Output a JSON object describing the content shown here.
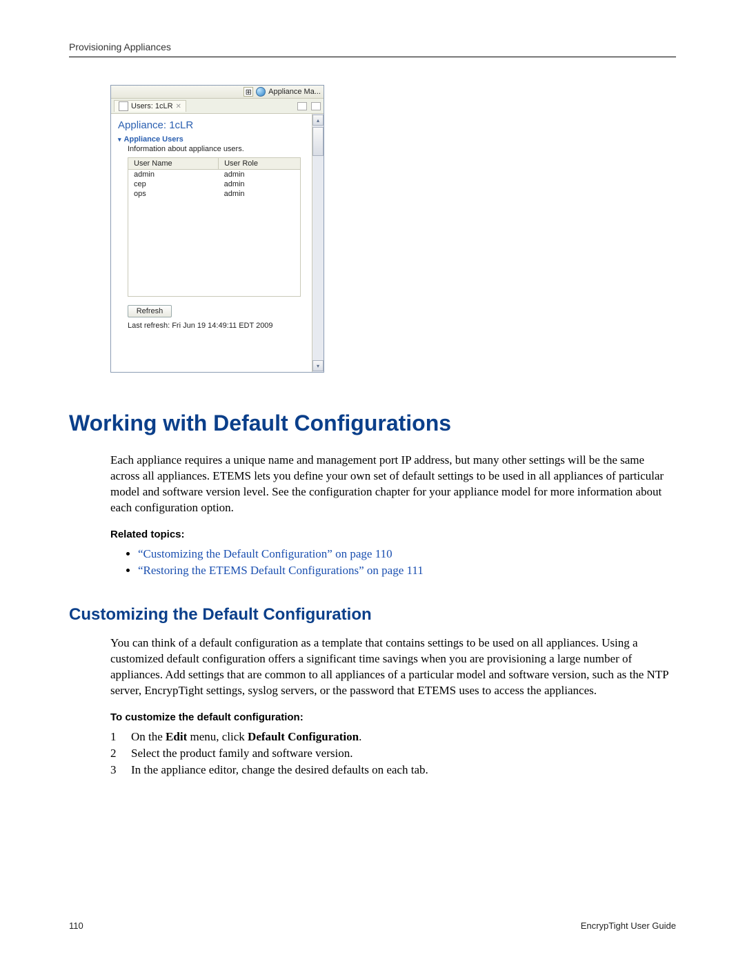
{
  "header": {
    "section": "Provisioning Appliances"
  },
  "screenshot": {
    "perspective_label": "Appliance Ma...",
    "tab_label": "Users: 1cLR",
    "panel_title": "Appliance: 1cLR",
    "section_title": "Appliance Users",
    "section_subtitle": "Information about appliance users.",
    "columns": [
      "User Name",
      "User Role"
    ],
    "rows": [
      {
        "name": "admin",
        "role": "admin"
      },
      {
        "name": "cep",
        "role": "admin"
      },
      {
        "name": "ops",
        "role": "admin"
      }
    ],
    "refresh_label": "Refresh",
    "status": "Last refresh: Fri Jun 19 14:49:11 EDT 2009"
  },
  "h1": "Working with Default Configurations",
  "para1": "Each appliance requires a unique name and management port IP address, but many other settings will be the same across all appliances. ETEMS lets you define your own set of default settings to be used in all appliances of particular model and software version level. See the configuration chapter for your appliance model for more information about each configuration option.",
  "related_heading": "Related topics:",
  "links": [
    "“Customizing the Default Configuration” on page 110",
    "“Restoring the ETEMS Default Configurations” on page 111"
  ],
  "h2": "Customizing the Default Configuration",
  "para2": "You can think of a default configuration as a template that contains settings to be used on all appliances. Using a customized default configuration offers a significant time savings when you are provisioning a large number of appliances. Add settings that are common to all appliances of a particular model and software version, such as the NTP server, EncrypTight settings, syslog servers, or the password that ETEMS uses to access the appliances.",
  "proc_heading": "To customize the default configuration:",
  "steps": {
    "s1_pre": "On the ",
    "s1_b1": "Edit",
    "s1_mid": " menu, click ",
    "s1_b2": "Default Configuration",
    "s1_post": ".",
    "s2": "Select the product family and software version.",
    "s3": "In the appliance editor, change the desired defaults on each tab."
  },
  "footer": {
    "page": "110",
    "doc": "EncrypTight User Guide"
  }
}
